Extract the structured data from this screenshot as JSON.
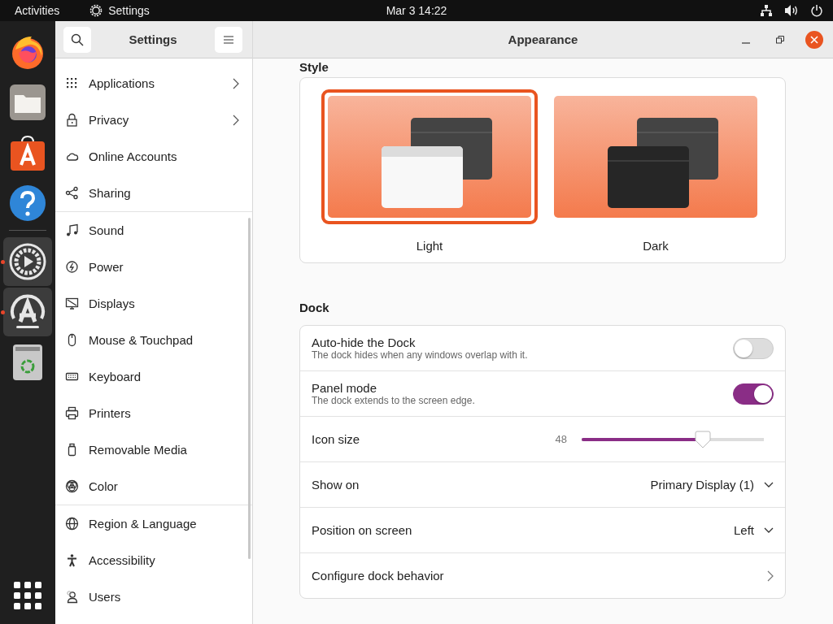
{
  "top_bar": {
    "activities": "Activities",
    "app_name": "Settings",
    "clock": "Mar 3  14:22"
  },
  "dock": {
    "apps": [
      {
        "kind": "browser",
        "running": false
      },
      {
        "kind": "files",
        "running": false
      },
      {
        "kind": "store",
        "running": false
      },
      {
        "kind": "help",
        "running": false
      },
      {
        "kind": "settings",
        "running": true
      },
      {
        "kind": "updater",
        "running": true
      },
      {
        "kind": "trash",
        "running": false
      }
    ]
  },
  "sidebar": {
    "title": "Settings",
    "groups": [
      [
        {
          "label": "Applications",
          "chevron": true,
          "selected": false
        },
        {
          "label": "Privacy",
          "chevron": true,
          "selected": false
        },
        {
          "label": "Online Accounts",
          "chevron": false,
          "selected": false
        },
        {
          "label": "Sharing",
          "chevron": false,
          "selected": false
        }
      ],
      [
        {
          "label": "Sound",
          "chevron": false,
          "selected": false
        },
        {
          "label": "Power",
          "chevron": false,
          "selected": false
        },
        {
          "label": "Displays",
          "chevron": false,
          "selected": false
        },
        {
          "label": "Mouse & Touchpad",
          "chevron": false,
          "selected": false
        },
        {
          "label": "Keyboard",
          "chevron": false,
          "selected": false
        },
        {
          "label": "Printers",
          "chevron": false,
          "selected": false
        },
        {
          "label": "Removable Media",
          "chevron": false,
          "selected": false
        },
        {
          "label": "Color",
          "chevron": false,
          "selected": false
        }
      ],
      [
        {
          "label": "Region & Language",
          "chevron": false,
          "selected": false
        },
        {
          "label": "Accessibility",
          "chevron": false,
          "selected": false
        },
        {
          "label": "Users",
          "chevron": false,
          "selected": false
        }
      ]
    ]
  },
  "window": {
    "title": "Appearance"
  },
  "style": {
    "heading": "Style",
    "options": [
      {
        "label": "Light",
        "kind": "light",
        "selected": true
      },
      {
        "label": "Dark",
        "kind": "dark",
        "selected": false
      }
    ]
  },
  "dock_settings": {
    "heading": "Dock",
    "rows": [
      {
        "kind": "switch",
        "title": "Auto-hide the Dock",
        "subtitle": "The dock hides when any windows overlap with it.",
        "on": false
      },
      {
        "kind": "switch",
        "title": "Panel mode",
        "subtitle": "The dock extends to the screen edge.",
        "on": true
      },
      {
        "kind": "slider",
        "title": "Icon size",
        "reading": "48",
        "level": 0.665
      },
      {
        "kind": "dropdown",
        "title": "Show on",
        "value": "Primary Display (1)"
      },
      {
        "kind": "dropdown",
        "title": "Position on screen",
        "value": "Left"
      },
      {
        "kind": "link",
        "title": "Configure dock behavior"
      }
    ]
  }
}
